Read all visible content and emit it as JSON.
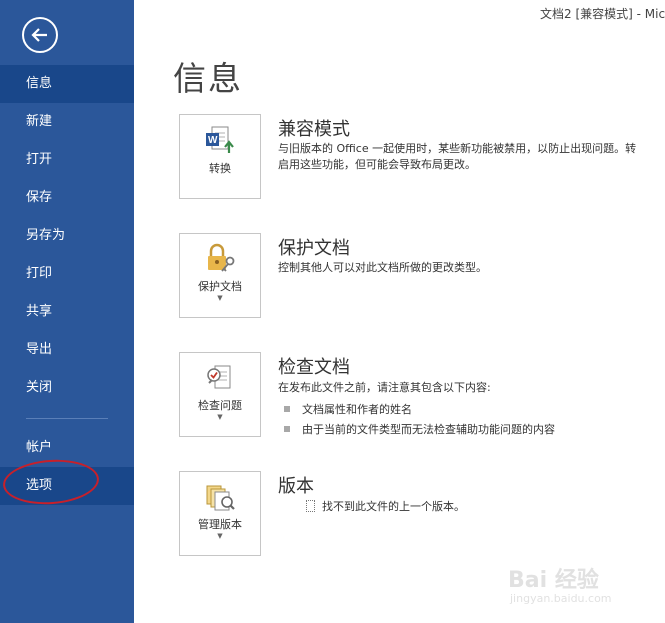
{
  "window": {
    "title": "文档2 [兼容模式] - Mic"
  },
  "sidebar": {
    "back_icon": "back-arrow-icon",
    "items": [
      {
        "label": "信息",
        "active": true
      },
      {
        "label": "新建"
      },
      {
        "label": "打开"
      },
      {
        "label": "保存"
      },
      {
        "label": "另存为"
      },
      {
        "label": "打印"
      },
      {
        "label": "共享"
      },
      {
        "label": "导出"
      },
      {
        "label": "关闭"
      }
    ],
    "bottom_items": [
      {
        "label": "帐户"
      },
      {
        "label": "选项",
        "highlighted": true
      }
    ],
    "colors": {
      "background": "#2b579a",
      "active": "#19478a",
      "annotation": "#c8202a"
    }
  },
  "main": {
    "page_title": "信息",
    "sections": [
      {
        "tile_label": "转换",
        "tile_icon": "word-convert-icon",
        "heading": "兼容模式",
        "text_lines": [
          "与旧版本的 Office 一起使用时，某些新功能被禁用，以防止出现问题。转",
          "启用这些功能，但可能会导致布局更改。"
        ]
      },
      {
        "tile_label": "保护文档",
        "tile_icon": "lock-key-icon",
        "heading": "保护文档",
        "text_lines": [
          "控制其他人可以对此文档所做的更改类型。"
        ]
      },
      {
        "tile_label": "检查问题",
        "tile_icon": "inspect-document-icon",
        "heading": "检查文档",
        "text_lines": [
          "在发布此文件之前，请注意其包含以下内容:"
        ],
        "bullets": [
          "文档属性和作者的姓名",
          "由于当前的文件类型而无法检查辅助功能问题的内容"
        ]
      },
      {
        "tile_label": "管理版本",
        "tile_icon": "manage-versions-icon",
        "heading": "版本",
        "text_lines": [
          "找不到此文件的上一个版本。"
        ]
      }
    ]
  },
  "watermark": {
    "main": "Bai 经验",
    "sub": "jingyan.baidu.com"
  }
}
